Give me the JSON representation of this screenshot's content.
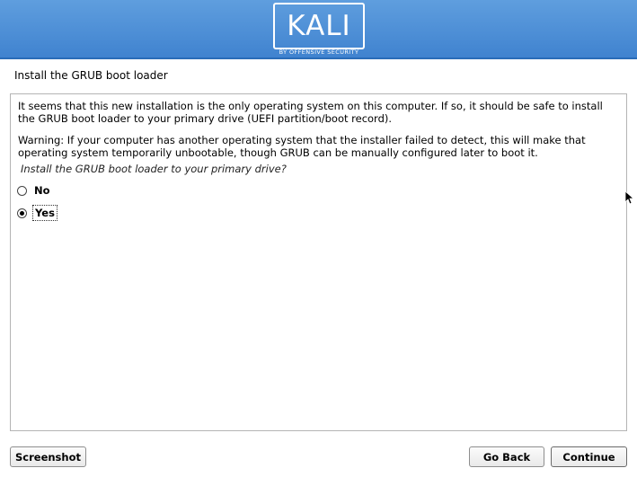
{
  "banner": {
    "logo_text": "KALI",
    "tagline": "BY OFFENSIVE SECURITY",
    "background_color": "#4a8fd6"
  },
  "page": {
    "title": "Install the GRUB boot loader"
  },
  "content": {
    "paragraph_1": "It seems that this new installation is the only operating system on this computer. If so, it should be safe to install the GRUB boot loader to your primary drive (UEFI partition/boot record).",
    "paragraph_2": "Warning: If your computer has another operating system that the installer failed to detect, this will make that operating system temporarily unbootable, though GRUB can be manually configured later to boot it.",
    "question": "Install the GRUB boot loader to your primary drive?",
    "options": [
      {
        "label": "No",
        "selected": false
      },
      {
        "label": "Yes",
        "selected": true
      }
    ]
  },
  "buttons": {
    "screenshot": "Screenshot",
    "go_back": "Go Back",
    "continue": "Continue"
  },
  "icons": {
    "cursor": "mouse-pointer-icon",
    "radio_off": "radio-unchecked-icon",
    "radio_on": "radio-checked-icon"
  }
}
